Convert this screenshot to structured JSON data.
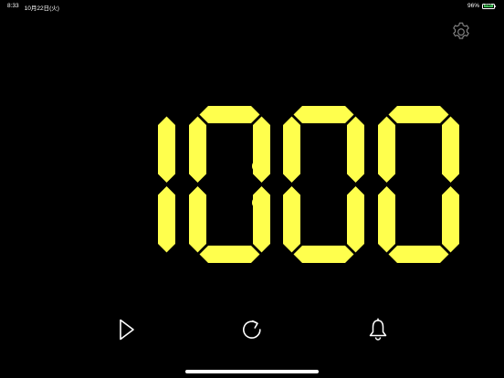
{
  "status_bar": {
    "time": "8:33",
    "date": "10月22日(火)",
    "battery_percent": "96%",
    "battery_label": "ENG",
    "battery_level": 0.96
  },
  "clock": {
    "display": "10:00",
    "digits": [
      "1",
      "0",
      "0",
      "0"
    ],
    "color": "#ffff4d",
    "background": "#000000"
  },
  "controls": {
    "play_icon": "play-icon",
    "reset_icon": "refresh-icon",
    "alarm_icon": "bell-icon",
    "settings_icon": "gear-icon"
  }
}
